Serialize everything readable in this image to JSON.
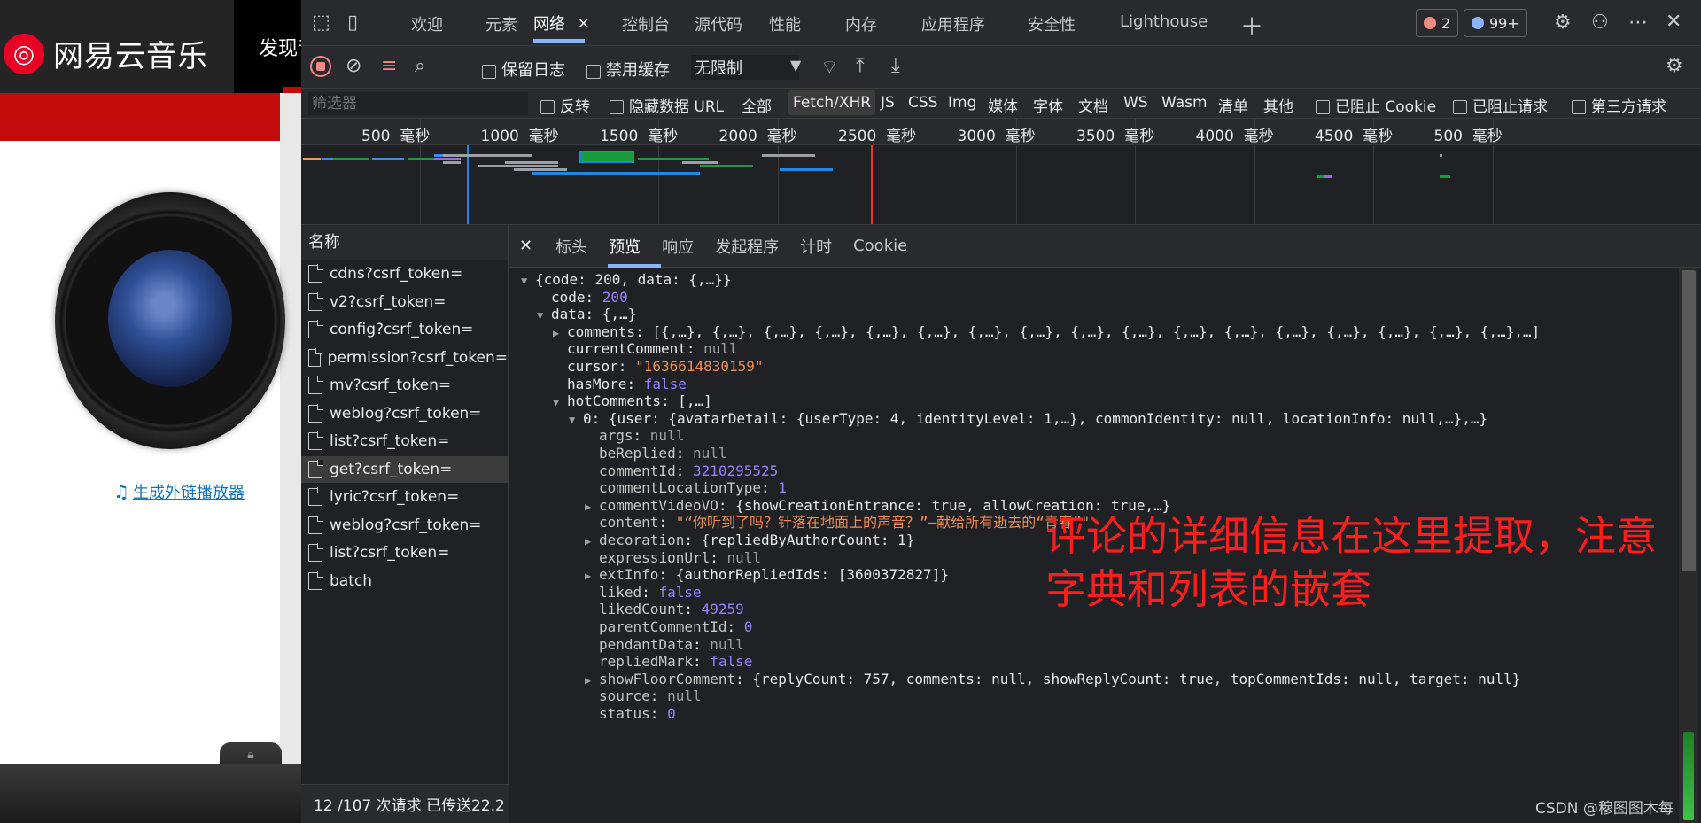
{
  "webpage": {
    "logo_glyph": "◎",
    "logo_text": "网易云音乐",
    "nav_item": "发现音乐",
    "embed_link": "生成外链播放器",
    "embed_icon": "music-note-icon",
    "lock_glyph": "🔒"
  },
  "devtools": {
    "top_tabs": [
      "欢迎",
      "元素",
      "网络",
      "控制台",
      "源代码",
      "性能",
      "内存",
      "应用程序",
      "安全性",
      "Lighthouse"
    ],
    "active_tab": "网络",
    "error_count": "2",
    "message_count": "99+",
    "toolbar": {
      "preserve_log": "保留日志",
      "disable_cache": "禁用缓存",
      "throttling": "无限制"
    },
    "filter": {
      "placeholder": "筛选器",
      "invert": "反转",
      "hide_data_urls": "隐藏数据 URL",
      "types": [
        "全部",
        "Fetch/XHR",
        "JS",
        "CSS",
        "Img",
        "媒体",
        "字体",
        "文档",
        "WS",
        "Wasm",
        "清单",
        "其他"
      ],
      "active_type": "Fetch/XHR",
      "blocked_cookies": "已阻止 Cookie",
      "blocked_requests": "已阻止请求",
      "third_party": "第三方请求"
    },
    "timeline": {
      "unit": "毫秒",
      "ticks": [
        "500",
        "1000",
        "1500",
        "2000",
        "2500",
        "3000",
        "3500",
        "4000",
        "4500",
        "500"
      ]
    },
    "requests": {
      "header": "名称",
      "items": [
        "cdns?csrf_token=",
        "v2?csrf_token=",
        "config?csrf_token=",
        "permission?csrf_token=",
        "mv?csrf_token=",
        "weblog?csrf_token=",
        "list?csrf_token=",
        "get?csrf_token=",
        "lyric?csrf_token=",
        "weblog?csrf_token=",
        "list?csrf_token=",
        "batch"
      ],
      "selected": "get?csrf_token=",
      "status": "12 /107 次请求   已传送22.2"
    },
    "detail_tabs": [
      "标头",
      "预览",
      "响应",
      "发起程序",
      "计时",
      "Cookie"
    ],
    "active_detail_tab": "预览",
    "preview_lines": [
      {
        "indent": 0,
        "arrow": "down",
        "key": "",
        "value": "{code: 200, data: {,…}}",
        "vtype": "plain"
      },
      {
        "indent": 1,
        "arrow": "",
        "key": "code",
        "value": "200",
        "vtype": "num"
      },
      {
        "indent": 1,
        "arrow": "down",
        "key": "data",
        "value": "{,…}",
        "vtype": "plain"
      },
      {
        "indent": 2,
        "arrow": "right",
        "key": "comments",
        "value": "[{,…}, {,…}, {,…}, {,…}, {,…}, {,…}, {,…}, {,…}, {,…}, {,…}, {,…}, {,…}, {,…}, {,…}, {,…}, {,…}, {,…},…]",
        "vtype": "plain"
      },
      {
        "indent": 2,
        "arrow": "",
        "key": "currentComment",
        "value": "null",
        "vtype": "null"
      },
      {
        "indent": 2,
        "arrow": "",
        "key": "cursor",
        "value": "\"1636614830159\"",
        "vtype": "str"
      },
      {
        "indent": 2,
        "arrow": "",
        "key": "hasMore",
        "value": "false",
        "vtype": "bool"
      },
      {
        "indent": 2,
        "arrow": "down",
        "key": "hotComments",
        "value": "[,…]",
        "vtype": "plain"
      },
      {
        "indent": 3,
        "arrow": "down",
        "key": "0",
        "value": "{user: {avatarDetail: {userType: 4, identityLevel: 1,…}, commonIdentity: null, locationInfo: null,…},…}",
        "vtype": "plain"
      },
      {
        "indent": 4,
        "arrow": "",
        "key": "args",
        "value": "null",
        "vtype": "null"
      },
      {
        "indent": 4,
        "arrow": "",
        "key": "beReplied",
        "value": "null",
        "vtype": "null"
      },
      {
        "indent": 4,
        "arrow": "",
        "key": "commentId",
        "value": "3210295525",
        "vtype": "num"
      },
      {
        "indent": 4,
        "arrow": "",
        "key": "commentLocationType",
        "value": "1",
        "vtype": "num"
      },
      {
        "indent": 4,
        "arrow": "right",
        "key": "commentVideoVO",
        "value": "{showCreationEntrance: true, allowCreation: true,…}",
        "vtype": "plain"
      },
      {
        "indent": 4,
        "arrow": "",
        "key": "content",
        "value": "\"“你听到了吗？针落在地面上的声音？”—献给所有逝去的“青春”\"",
        "vtype": "str"
      },
      {
        "indent": 4,
        "arrow": "right",
        "key": "decoration",
        "value": "{repliedByAuthorCount: 1}",
        "vtype": "plain"
      },
      {
        "indent": 4,
        "arrow": "",
        "key": "expressionUrl",
        "value": "null",
        "vtype": "null"
      },
      {
        "indent": 4,
        "arrow": "right",
        "key": "extInfo",
        "value": "{authorRepliedIds: [3600372827]}",
        "vtype": "plain"
      },
      {
        "indent": 4,
        "arrow": "",
        "key": "liked",
        "value": "false",
        "vtype": "bool"
      },
      {
        "indent": 4,
        "arrow": "",
        "key": "likedCount",
        "value": "49259",
        "vtype": "num"
      },
      {
        "indent": 4,
        "arrow": "",
        "key": "parentCommentId",
        "value": "0",
        "vtype": "num"
      },
      {
        "indent": 4,
        "arrow": "",
        "key": "pendantData",
        "value": "null",
        "vtype": "null"
      },
      {
        "indent": 4,
        "arrow": "",
        "key": "repliedMark",
        "value": "false",
        "vtype": "bool"
      },
      {
        "indent": 4,
        "arrow": "right",
        "key": "showFloorComment",
        "value": "{replyCount: 757, comments: null, showReplyCount: true, topCommentIds: null, target: null}",
        "vtype": "plain"
      },
      {
        "indent": 4,
        "arrow": "",
        "key": "source",
        "value": "null",
        "vtype": "null"
      },
      {
        "indent": 4,
        "arrow": "",
        "key": "status",
        "value": "0",
        "vtype": "num"
      }
    ],
    "annotation_lines": [
      "评论的详细信息在这里提取，注意",
      "字典和列表的嵌套"
    ],
    "annotation_color": "#ff1e1e"
  },
  "watermark": "CSDN @穆图图木每",
  "colors": {
    "devtools_bg": "#292a2d",
    "accent": "#8ab4f8",
    "brand_red": "#c20c0c"
  }
}
